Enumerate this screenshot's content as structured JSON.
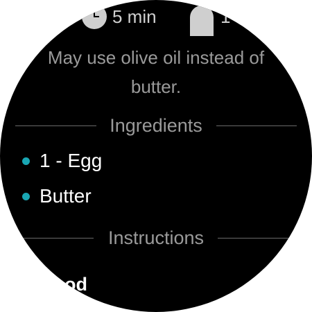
{
  "meta": {
    "time_icon": "clock-icon",
    "time_text": "5 min",
    "servings_icon": "person-icon",
    "servings_text": "1"
  },
  "note": {
    "line1": "May use olive oil instead of",
    "line2": "butter."
  },
  "ingredients": {
    "title": "Ingredients",
    "items": [
      {
        "text": "1 - Egg"
      },
      {
        "text": "Butter"
      }
    ],
    "bullet_color": "#19a6b3"
  },
  "instructions": {
    "title": "Instructions",
    "method_heading": "Method"
  },
  "colors": {
    "background": "#000000",
    "primary_text": "#ffffff",
    "secondary_text": "#9a9a9a",
    "accent": "#19a6b3"
  }
}
